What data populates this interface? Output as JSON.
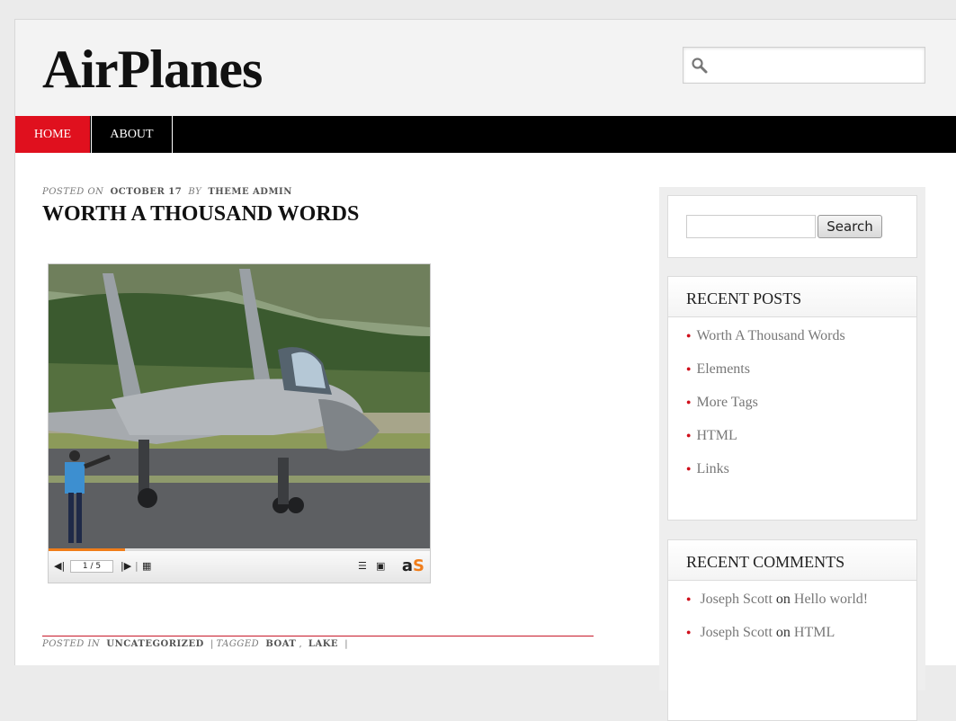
{
  "site": {
    "title": "AirPlanes"
  },
  "header_search": {
    "placeholder": ""
  },
  "nav": {
    "items": [
      {
        "label": "HOME"
      },
      {
        "label": "ABOUT"
      }
    ]
  },
  "post": {
    "meta": {
      "posted_on": "POSTED ON",
      "date": "OCTOBER 17",
      "by": "BY",
      "author": "THEME ADMIN"
    },
    "title": "WORTH A THOUSAND WORDS",
    "gallery": {
      "counter": "1 / 5",
      "brand_a": "a",
      "brand_s": "S",
      "progress": 0.2
    },
    "footer": {
      "posted_in": "POSTED IN",
      "category": "UNCATEGORIZED",
      "tagged": "TAGGED",
      "tags": [
        "BOAT",
        "LAKE"
      ]
    }
  },
  "sidebar": {
    "search": {
      "button": "Search"
    },
    "recent_posts": {
      "heading": "RECENT POSTS",
      "items": [
        "Worth A Thousand Words",
        "Elements",
        "More Tags",
        "HTML",
        "Links"
      ]
    },
    "recent_comments": {
      "heading": "RECENT COMMENTS",
      "items": [
        {
          "author": "Joseph Scott",
          "on": "on",
          "post": "Hello world!"
        },
        {
          "author": "Joseph Scott",
          "on": "on",
          "post": "HTML"
        }
      ]
    }
  },
  "colors": {
    "accent": "#e0101e",
    "nav_bg": "#000000",
    "bullet": "#d0101c",
    "progress": "#f07d1a"
  }
}
